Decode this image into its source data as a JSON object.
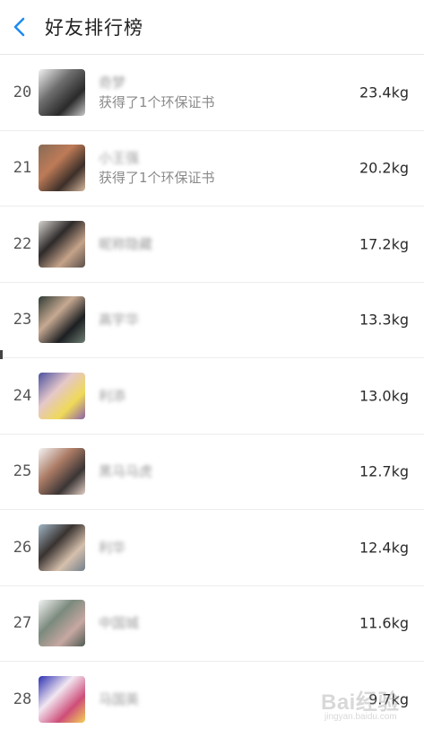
{
  "header": {
    "title": "好友排行榜",
    "back_icon": "chevron-left-icon",
    "accent_color": "#1E8CF0"
  },
  "rows": [
    {
      "rank": "20",
      "name": "奇梦",
      "subtitle": "获得了1个环保证书",
      "weight": "23.4kg",
      "avatar_colors": [
        "#f2f2f2",
        "#6e6e6e",
        "#2a2a2a",
        "#c9c9c9"
      ]
    },
    {
      "rank": "21",
      "name": "小王强",
      "subtitle": "获得了1个环保证书",
      "weight": "20.2kg",
      "avatar_colors": [
        "#8a6a54",
        "#c47a52",
        "#3e2f28",
        "#d9b99b"
      ]
    },
    {
      "rank": "22",
      "name": "昵称隐藏",
      "subtitle": "",
      "weight": "17.2kg",
      "avatar_colors": [
        "#d7d5d0",
        "#2e2a2a",
        "#c8a286",
        "#5a4f48"
      ]
    },
    {
      "rank": "23",
      "name": "高宇华",
      "subtitle": "",
      "weight": "13.3kg",
      "avatar_colors": [
        "#2f3b34",
        "#c9a98f",
        "#1c1f22",
        "#6d7f73"
      ]
    },
    {
      "rank": "24",
      "name": "利添",
      "subtitle": "",
      "weight": "13.0kg",
      "avatar_colors": [
        "#4a4fa8",
        "#e8c7c9",
        "#f2d94a",
        "#8e5fb0"
      ]
    },
    {
      "rank": "25",
      "name": "黑马马虎",
      "subtitle": "",
      "weight": "12.7kg",
      "avatar_colors": [
        "#f5f5f5",
        "#b07a62",
        "#3b3535",
        "#e5cfc4"
      ]
    },
    {
      "rank": "26",
      "name": "利华",
      "subtitle": "",
      "weight": "12.4kg",
      "avatar_colors": [
        "#9fb6c8",
        "#3a3330",
        "#d8c0aa",
        "#6f7f8c"
      ]
    },
    {
      "rank": "27",
      "name": "中国城",
      "subtitle": "",
      "weight": "11.6kg",
      "avatar_colors": [
        "#f4f4f4",
        "#7a8a7c",
        "#c9a7a0",
        "#4d5b52"
      ]
    },
    {
      "rank": "28",
      "name": "马国英",
      "subtitle": "",
      "weight": "9.7kg",
      "avatar_colors": [
        "#2b2fbf",
        "#f2e6f2",
        "#d94a7a",
        "#f7d24a"
      ]
    }
  ],
  "watermark": {
    "text": "Bai经验",
    "url": "jingyan.baidu.com"
  }
}
